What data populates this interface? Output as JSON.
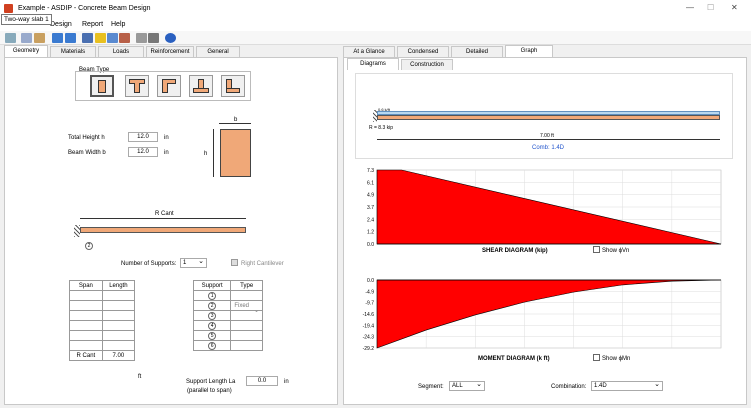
{
  "window": {
    "title": "Example - ASDIP - Concrete Beam Design",
    "tooltip": "Two-way slab 1",
    "controls": {
      "minimize": "—",
      "maximize": "☐",
      "close": "✕"
    }
  },
  "menu": {
    "items": [
      "Design",
      "Report",
      "Help"
    ]
  },
  "left_tabs": [
    "Geometry",
    "Materials",
    "Loads",
    "Reinforcement",
    "General"
  ],
  "right_tabs": [
    "At a Glance",
    "Condensed",
    "Detailed",
    "Graph"
  ],
  "sub_tabs": [
    "Diagrams",
    "Construction"
  ],
  "geometry": {
    "beam_type_label": "Beam Type",
    "total_height_label": "Total Height  h",
    "total_height": "12.0",
    "beam_width_label": "Beam Width  b",
    "beam_width": "12.0",
    "unit_in": "in",
    "section_b": "b",
    "section_h": "h",
    "cant_label": "R Cant",
    "support_num": "2",
    "num_supports_label": "Number of Supports:",
    "num_supports": "1",
    "right_cantilever_label": "Right Cantilever",
    "span_headers": [
      "Span",
      "Length"
    ],
    "span_footer_label": "R Cant",
    "span_footer_value": "7.00",
    "unit_ft": "ft",
    "support_headers": [
      "Support",
      "Type"
    ],
    "supports": [
      {
        "n": "1",
        "type": ""
      },
      {
        "n": "2",
        "type": "Fixed"
      },
      {
        "n": "3",
        "type": ""
      },
      {
        "n": "4",
        "type": ""
      },
      {
        "n": "5",
        "type": ""
      },
      {
        "n": "6",
        "type": ""
      }
    ],
    "support_length_label": "Support Length  La",
    "support_length_sub": "(parallel to span)",
    "support_length": "0.0"
  },
  "graph": {
    "load_label": "R = 8.3 kip",
    "load_top": "0.6 k/ft",
    "span_label": "7.00 ft",
    "comb": "Comb: 1.4D",
    "shear_title": "SHEAR DIAGRAM (kip)",
    "shear_show": "Show ϕVn",
    "moment_title": "MOMENT DIAGRAM (k ft)",
    "moment_show": "Show ϕMn",
    "segment_label": "Segment:",
    "segment": "ALL",
    "combination_label": "Combination:",
    "combination": "1.4D"
  },
  "chart_data": [
    {
      "type": "area",
      "title": "SHEAR DIAGRAM (kip)",
      "y_ticks": [
        "7.3",
        "6.1",
        "4.9",
        "3.7",
        "2.4",
        "1.2",
        "0.0"
      ],
      "ylim": [
        0,
        7.3
      ],
      "x": [
        0,
        0.5,
        7.0
      ],
      "values": [
        7.3,
        7.3,
        0
      ],
      "color": "#ff0000"
    },
    {
      "type": "area",
      "title": "MOMENT DIAGRAM (k ft)",
      "y_ticks": [
        "0.0",
        "-4.9",
        "-9.7",
        "-14.6",
        "-19.4",
        "-24.3",
        "-29.2"
      ],
      "ylim": [
        -29.2,
        0
      ],
      "x": [
        0,
        1,
        2,
        3,
        4,
        5,
        6,
        7
      ],
      "values": [
        -29.2,
        -21.5,
        -15.0,
        -9.5,
        -5.2,
        -2.1,
        -0.5,
        0
      ],
      "color": "#ff0000"
    }
  ],
  "colors": {
    "accent": "#0078d7",
    "beam": "#f0a878",
    "fill": "#ff0000"
  }
}
